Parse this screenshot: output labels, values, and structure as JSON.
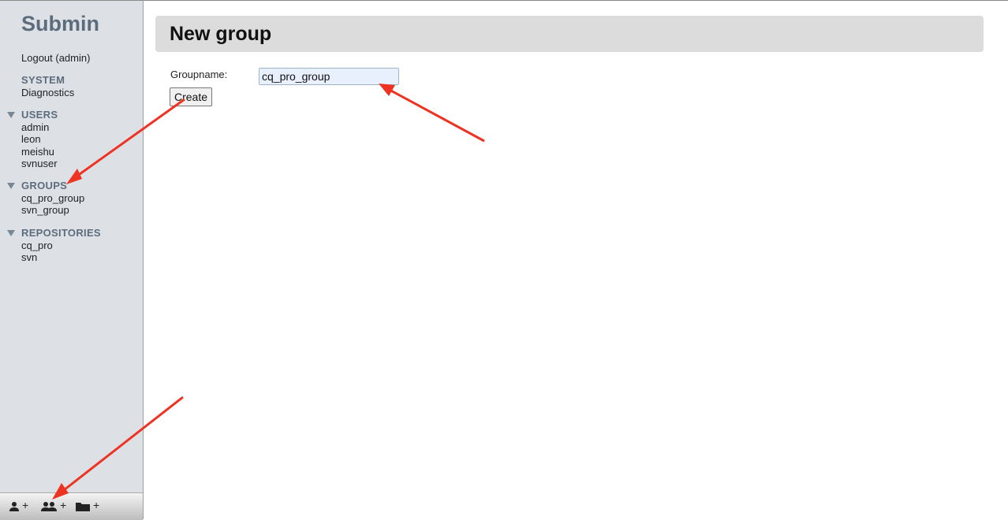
{
  "sidebar": {
    "brand": "Submin",
    "logout": "Logout (admin)",
    "system": {
      "heading": "SYSTEM",
      "items": [
        "Diagnostics"
      ]
    },
    "users": {
      "heading": "USERS",
      "items": [
        "admin",
        "leon",
        "meishu",
        "svnuser"
      ]
    },
    "groups": {
      "heading": "GROUPS",
      "items": [
        "cq_pro_group",
        "svn_group"
      ]
    },
    "repositories": {
      "heading": "REPOSITORIES",
      "items": [
        "cq_pro",
        "svn"
      ]
    },
    "toolbar": {
      "add_user": "+",
      "add_group": "+",
      "add_repository": "+"
    }
  },
  "main": {
    "title": "New group",
    "form": {
      "groupname_label": "Groupname:",
      "groupname_value": "cq_pro_group",
      "create_label": "Create"
    }
  },
  "colors": {
    "annotation_arrow": "#ee3322",
    "sidebar_bg": "#dde1e6",
    "heading": "#5d6c7c"
  }
}
